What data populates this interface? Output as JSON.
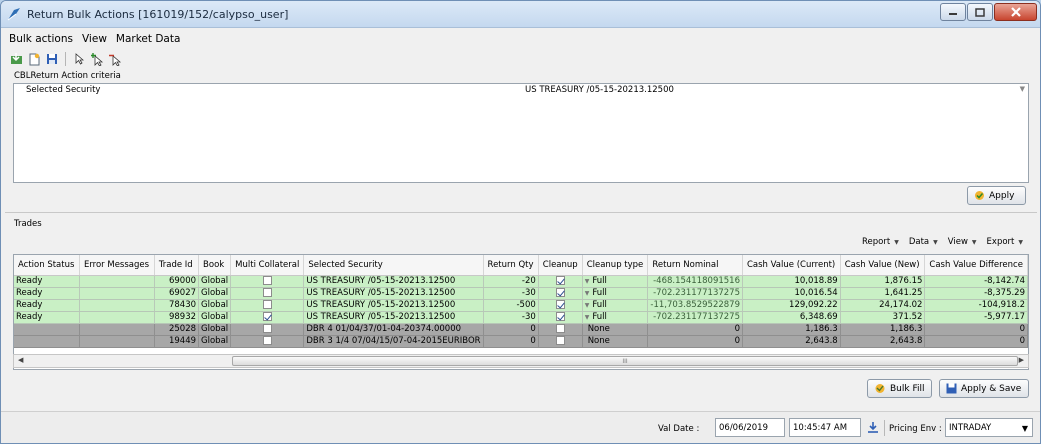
{
  "window": {
    "title": "Return Bulk Actions [161019/152/calypso_user]"
  },
  "menu": [
    "Bulk actions",
    "View",
    "Market Data"
  ],
  "toolbar": {
    "icons": [
      "import-icon",
      "new-document-icon",
      "save-icon",
      "pointer-icon",
      "pointer-add-icon",
      "pointer-remove-icon"
    ]
  },
  "criteria": {
    "section_label": "CBLReturn Action criteria",
    "row_label": "Selected Security",
    "row_value": "US TREASURY /05-15-20213.12500",
    "apply_label": "Apply"
  },
  "trades": {
    "section_label": "Trades",
    "actions": [
      "Report",
      "Data",
      "View",
      "Export"
    ],
    "columns": [
      "Action Status",
      "Error Messages",
      "Trade Id",
      "Book",
      "Multi Collateral",
      "Selected Security",
      "Return Qty",
      "Cleanup",
      "Cleanup type",
      "Return Nominal",
      "Cash Value (Current)",
      "Cash Value (New)",
      "Cash Value Difference"
    ],
    "rows": [
      {
        "status": "Ready",
        "error": "",
        "trade_id": "69000",
        "book": "Global",
        "multi": false,
        "security": "US TREASURY /05-15-20213.12500",
        "qty": "-20",
        "cleanup": true,
        "cleanup_type": "Full",
        "nominal": "-468.154118091516",
        "cash_current": "10,018.89",
        "cash_new": "1,876.15",
        "cash_diff": "-8,142.74",
        "kind": "ready"
      },
      {
        "status": "Ready",
        "error": "",
        "trade_id": "69027",
        "book": "Global",
        "multi": false,
        "security": "US TREASURY /05-15-20213.12500",
        "qty": "-30",
        "cleanup": true,
        "cleanup_type": "Full",
        "nominal": "-702.231177137275",
        "cash_current": "10,016.54",
        "cash_new": "1,641.25",
        "cash_diff": "-8,375.29",
        "kind": "ready"
      },
      {
        "status": "Ready",
        "error": "",
        "trade_id": "78430",
        "book": "Global",
        "multi": false,
        "security": "US TREASURY /05-15-20213.12500",
        "qty": "-500",
        "cleanup": true,
        "cleanup_type": "Full",
        "nominal": "-11,703.8529522879",
        "cash_current": "129,092.22",
        "cash_new": "24,174.02",
        "cash_diff": "-104,918.2",
        "kind": "ready"
      },
      {
        "status": "Ready",
        "error": "",
        "trade_id": "98932",
        "book": "Global",
        "multi": true,
        "security": "US TREASURY /05-15-20213.12500",
        "qty": "-30",
        "cleanup": true,
        "cleanup_type": "Full",
        "nominal": "-702.231177137275",
        "cash_current": "6,348.69",
        "cash_new": "371.52",
        "cash_diff": "-5,977.17",
        "kind": "ready"
      },
      {
        "status": "",
        "error": "",
        "trade_id": "25028",
        "book": "Global",
        "multi": false,
        "security": "DBR 4 01/04/37/01-04-20374.00000",
        "qty": "0",
        "cleanup": false,
        "cleanup_type": "None",
        "nominal": "0",
        "cash_current": "1,186.3",
        "cash_new": "1,186.3",
        "cash_diff": "0",
        "kind": "none"
      },
      {
        "status": "",
        "error": "",
        "trade_id": "19449",
        "book": "Global",
        "multi": false,
        "security": "DBR 3 1/4 07/04/15/07-04-2015EURIBOR",
        "qty": "0",
        "cleanup": false,
        "cleanup_type": "None",
        "nominal": "0",
        "cash_current": "2,643.8",
        "cash_new": "2,643.8",
        "cash_diff": "0",
        "kind": "none"
      }
    ],
    "scroll_thumb": "III"
  },
  "buttons": {
    "bulk_fill": "Bulk Fill",
    "apply_save": "Apply & Save"
  },
  "status": {
    "val_date_label": "Val Date :",
    "val_date": "06/06/2019",
    "time": "10:45:47 AM",
    "pricing_env_label": "Pricing Env :",
    "pricing_env": "INTRADAY"
  },
  "colors": {
    "ready_row": "#c9f0c5",
    "none_row": "#a7a7a7",
    "title_bar": "#c4d8ef"
  }
}
